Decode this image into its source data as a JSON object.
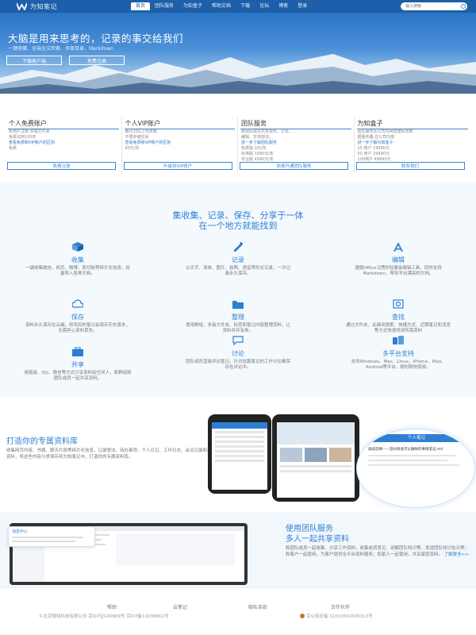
{
  "header": {
    "logo_text": "为知笔记",
    "nav": [
      "首页",
      "团队服务",
      "为知盒子",
      "帮助文档",
      "下载",
      "论坛",
      "博客",
      "登录"
    ],
    "search_placeholder": "输入搜索",
    "brand_color": "#1d5fa8"
  },
  "hero": {
    "title": "大脑是用来思考的，记录的事交给我们",
    "subtitle": "一键收藏、全端全文检索、多级目录、Markdown",
    "download_label": "下载客户端",
    "register_label": "免费注册"
  },
  "cards": [
    {
      "title": "个人免费账户",
      "lines": [
        "新用户注册,多端文件夹",
        "免费试用100天",
        "查看免费和VIP账户的区别",
        "",
        "免费"
      ],
      "link_index": 2,
      "button": "免费注册"
    },
    {
      "title": "个人VIP账户",
      "lines": [
        "每月10G上传流量",
        "不限存储空间",
        "查看免费和VIP账户的区别",
        "",
        "60元/年"
      ],
      "link_index": 2,
      "button": "升级到VIP账户"
    },
    {
      "title": "团队服务",
      "lines": [
        "和团队成员共享资料、讨论、",
        "编辑、交流想法。",
        "进一步了解团队服务",
        "免费版 0元/年",
        "标准版 1990元/年",
        "专业版 4990元/年"
      ],
      "link_index": 2,
      "button": "免费开通团队服务"
    },
    {
      "title": "为知盒子",
      "lines": [
        "团队服务在公司内网搭建私有数",
        "据服务器,在公司内部",
        "进一步了解为知盒子",
        "25 用户 19990元",
        "50 用户 29990元",
        "100用户 49990元"
      ],
      "link_index": 2,
      "button": "联系我们"
    }
  ],
  "features": {
    "heading1": "集收集、记录、保存、分享于一体",
    "heading2": "在一个地方就能找到",
    "items": [
      {
        "icon": "box-icon",
        "title": "收集",
        "desc": "一键收集微信、网页、微博、剪切板等碎片化信息，批量导入各种文档。"
      },
      {
        "icon": "pen-icon",
        "title": "记录",
        "desc": "以文字、清单、图片、拍照、语音等形式记录，一次记录永久保存。"
      },
      {
        "icon": "edit-icon",
        "title": "编辑",
        "desc": "遵循Office习惯的轻量级编辑工具，同时支持Markdown，帮你写出漂亮的文档。"
      },
      {
        "icon": "cloud-icon",
        "title": "保存",
        "desc": "资料永久保存在云端，修改后的笔记会保存历史版本，无需担心资料丢失。"
      },
      {
        "icon": "folder-icon",
        "title": "整理",
        "desc": "使用群组、多级文件夹、标签和笔记内链整理资料，让资料井井有条。"
      },
      {
        "icon": "search-icon",
        "title": "查找",
        "desc": "通过文件夹、关键词搜索、快捷方式、近期笔记和消息等方式快速找到所需资料"
      },
      {
        "icon": "share-icon",
        "title": "共享",
        "desc": "用链接、QQ、微信等方式分享资料给任何人，和群组和团队成员一起共享资料。"
      },
      {
        "icon": "chat-icon",
        "title": "讨论",
        "desc": "团队成员直接评论笔记，针对这篇笔记的工作讨论都保存在评论中。"
      },
      {
        "icon": "devices-icon",
        "title": "多平台支持",
        "desc": "支持Windows、Mac、Linux、iPhone、iPad、Android等平台，随时随地使用。"
      }
    ]
  },
  "mobile": {
    "title": "打造你的专属资料库",
    "desc": "收集网页内容、书摘、聊天片段等碎片化信息，记录想法、待办事项、个人日记、工作日志、会议记录和项目资料，将这些内容分类保存到为知笔记中，打造你的专属资料库。",
    "circle_label": "个人笔记",
    "circle_item": "再续前缘——温州商会可以做样的事情笔记.md"
  },
  "team": {
    "title1": "使用团队服务",
    "title2": "多人一起共享资料",
    "desc": "和团队成员一起收集、分享工作资料，收集成员意见、讲解团队知识等，发送团队知识告示等；和客户一起使用，为客户提供全平台资料服务；和家人一起使用，共享家庭资料。",
    "more": "了解更多>>",
    "message_label": "消息中心"
  },
  "footer": {
    "links": [
      "帮助",
      "云笔记",
      "隐私条款",
      "合作伙伴"
    ],
    "copyright": "©北京微知科技有限公司 京ICP证140809号 京ICP备11038801号",
    "police": "京公网安备 11010502036313号"
  }
}
